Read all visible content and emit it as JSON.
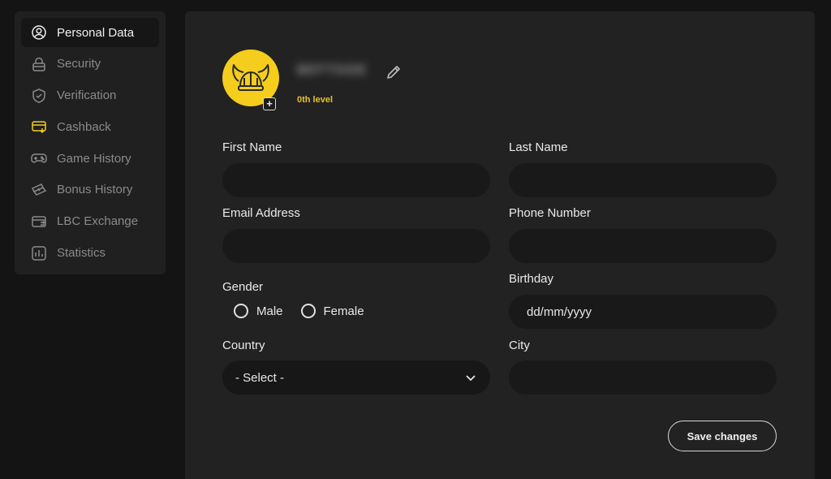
{
  "sidebar": {
    "items": [
      {
        "label": "Personal Data",
        "icon": "user-circle-icon",
        "active": true
      },
      {
        "label": "Security",
        "icon": "lock-icon"
      },
      {
        "label": "Verification",
        "icon": "shield-check-icon"
      },
      {
        "label": "Cashback",
        "icon": "cashback-card-icon"
      },
      {
        "label": "Game History",
        "icon": "gamepad-icon"
      },
      {
        "label": "Bonus History",
        "icon": "bonus-ticket-icon"
      },
      {
        "label": "LBC Exchange",
        "icon": "exchange-card-icon"
      },
      {
        "label": "Statistics",
        "icon": "bar-chart-icon"
      }
    ]
  },
  "profile": {
    "username": "BEFTSIDE",
    "level": "0th level",
    "accent_color": "#f5cd1d"
  },
  "form": {
    "first_name_label": "First Name",
    "last_name_label": "Last Name",
    "email_label": "Email Address",
    "phone_label": "Phone Number",
    "gender_label": "Gender",
    "gender_options": [
      "Male",
      "Female"
    ],
    "birthday_label": "Birthday",
    "birthday_placeholder": "dd/mm/yyyy",
    "country_label": "Country",
    "country_value": "- Select -",
    "city_label": "City",
    "save_label": "Save changes"
  }
}
